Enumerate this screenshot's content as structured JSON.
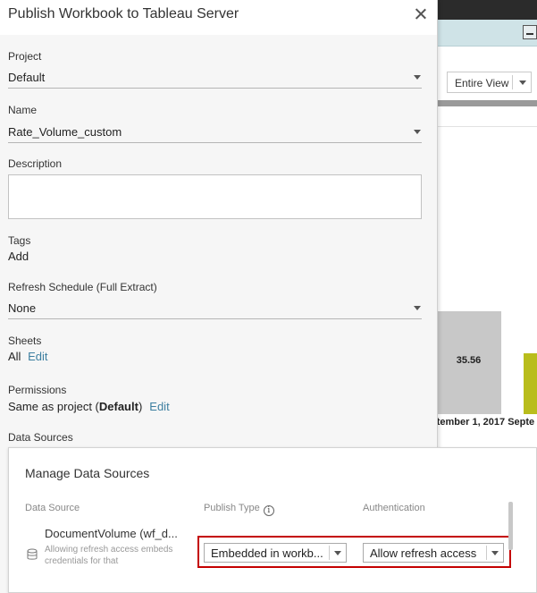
{
  "dialog": {
    "title": "Publish Workbook to Tableau Server",
    "project": {
      "label": "Project",
      "value": "Default"
    },
    "name": {
      "label": "Name",
      "value": "Rate_Volume_custom"
    },
    "description": {
      "label": "Description",
      "value": ""
    },
    "tags": {
      "label": "Tags",
      "add_link": "Add"
    },
    "refresh": {
      "label": "Refresh Schedule (Full Extract)",
      "value": "None"
    },
    "sheets": {
      "label": "Sheets",
      "value": "All",
      "edit_link": "Edit"
    },
    "permissions": {
      "label": "Permissions",
      "prefix": "Same as project (",
      "bold": "Default",
      "suffix": ")",
      "edit_link": "Edit"
    },
    "data_sources": {
      "label": "Data Sources"
    }
  },
  "manage": {
    "title": "Manage Data Sources",
    "columns": {
      "source": "Data Source",
      "publish_type": "Publish Type",
      "authentication": "Authentication"
    },
    "row": {
      "name": "DocumentVolume (wf_d...",
      "note": "Allowing refresh access embeds credentials for that",
      "publish_type": "Embedded in workb...",
      "authentication": "Allow refresh access"
    }
  },
  "background": {
    "view_select": "Entire View",
    "bar_label": "35.56",
    "x_label": "ptember 1, 2017  Septe",
    "edge_char": "e"
  },
  "colors": {
    "link": "#3d7fa0",
    "highlight": "#c40000",
    "bar_grey": "#c8c8c8",
    "bar_olive": "#b9bd1c"
  }
}
